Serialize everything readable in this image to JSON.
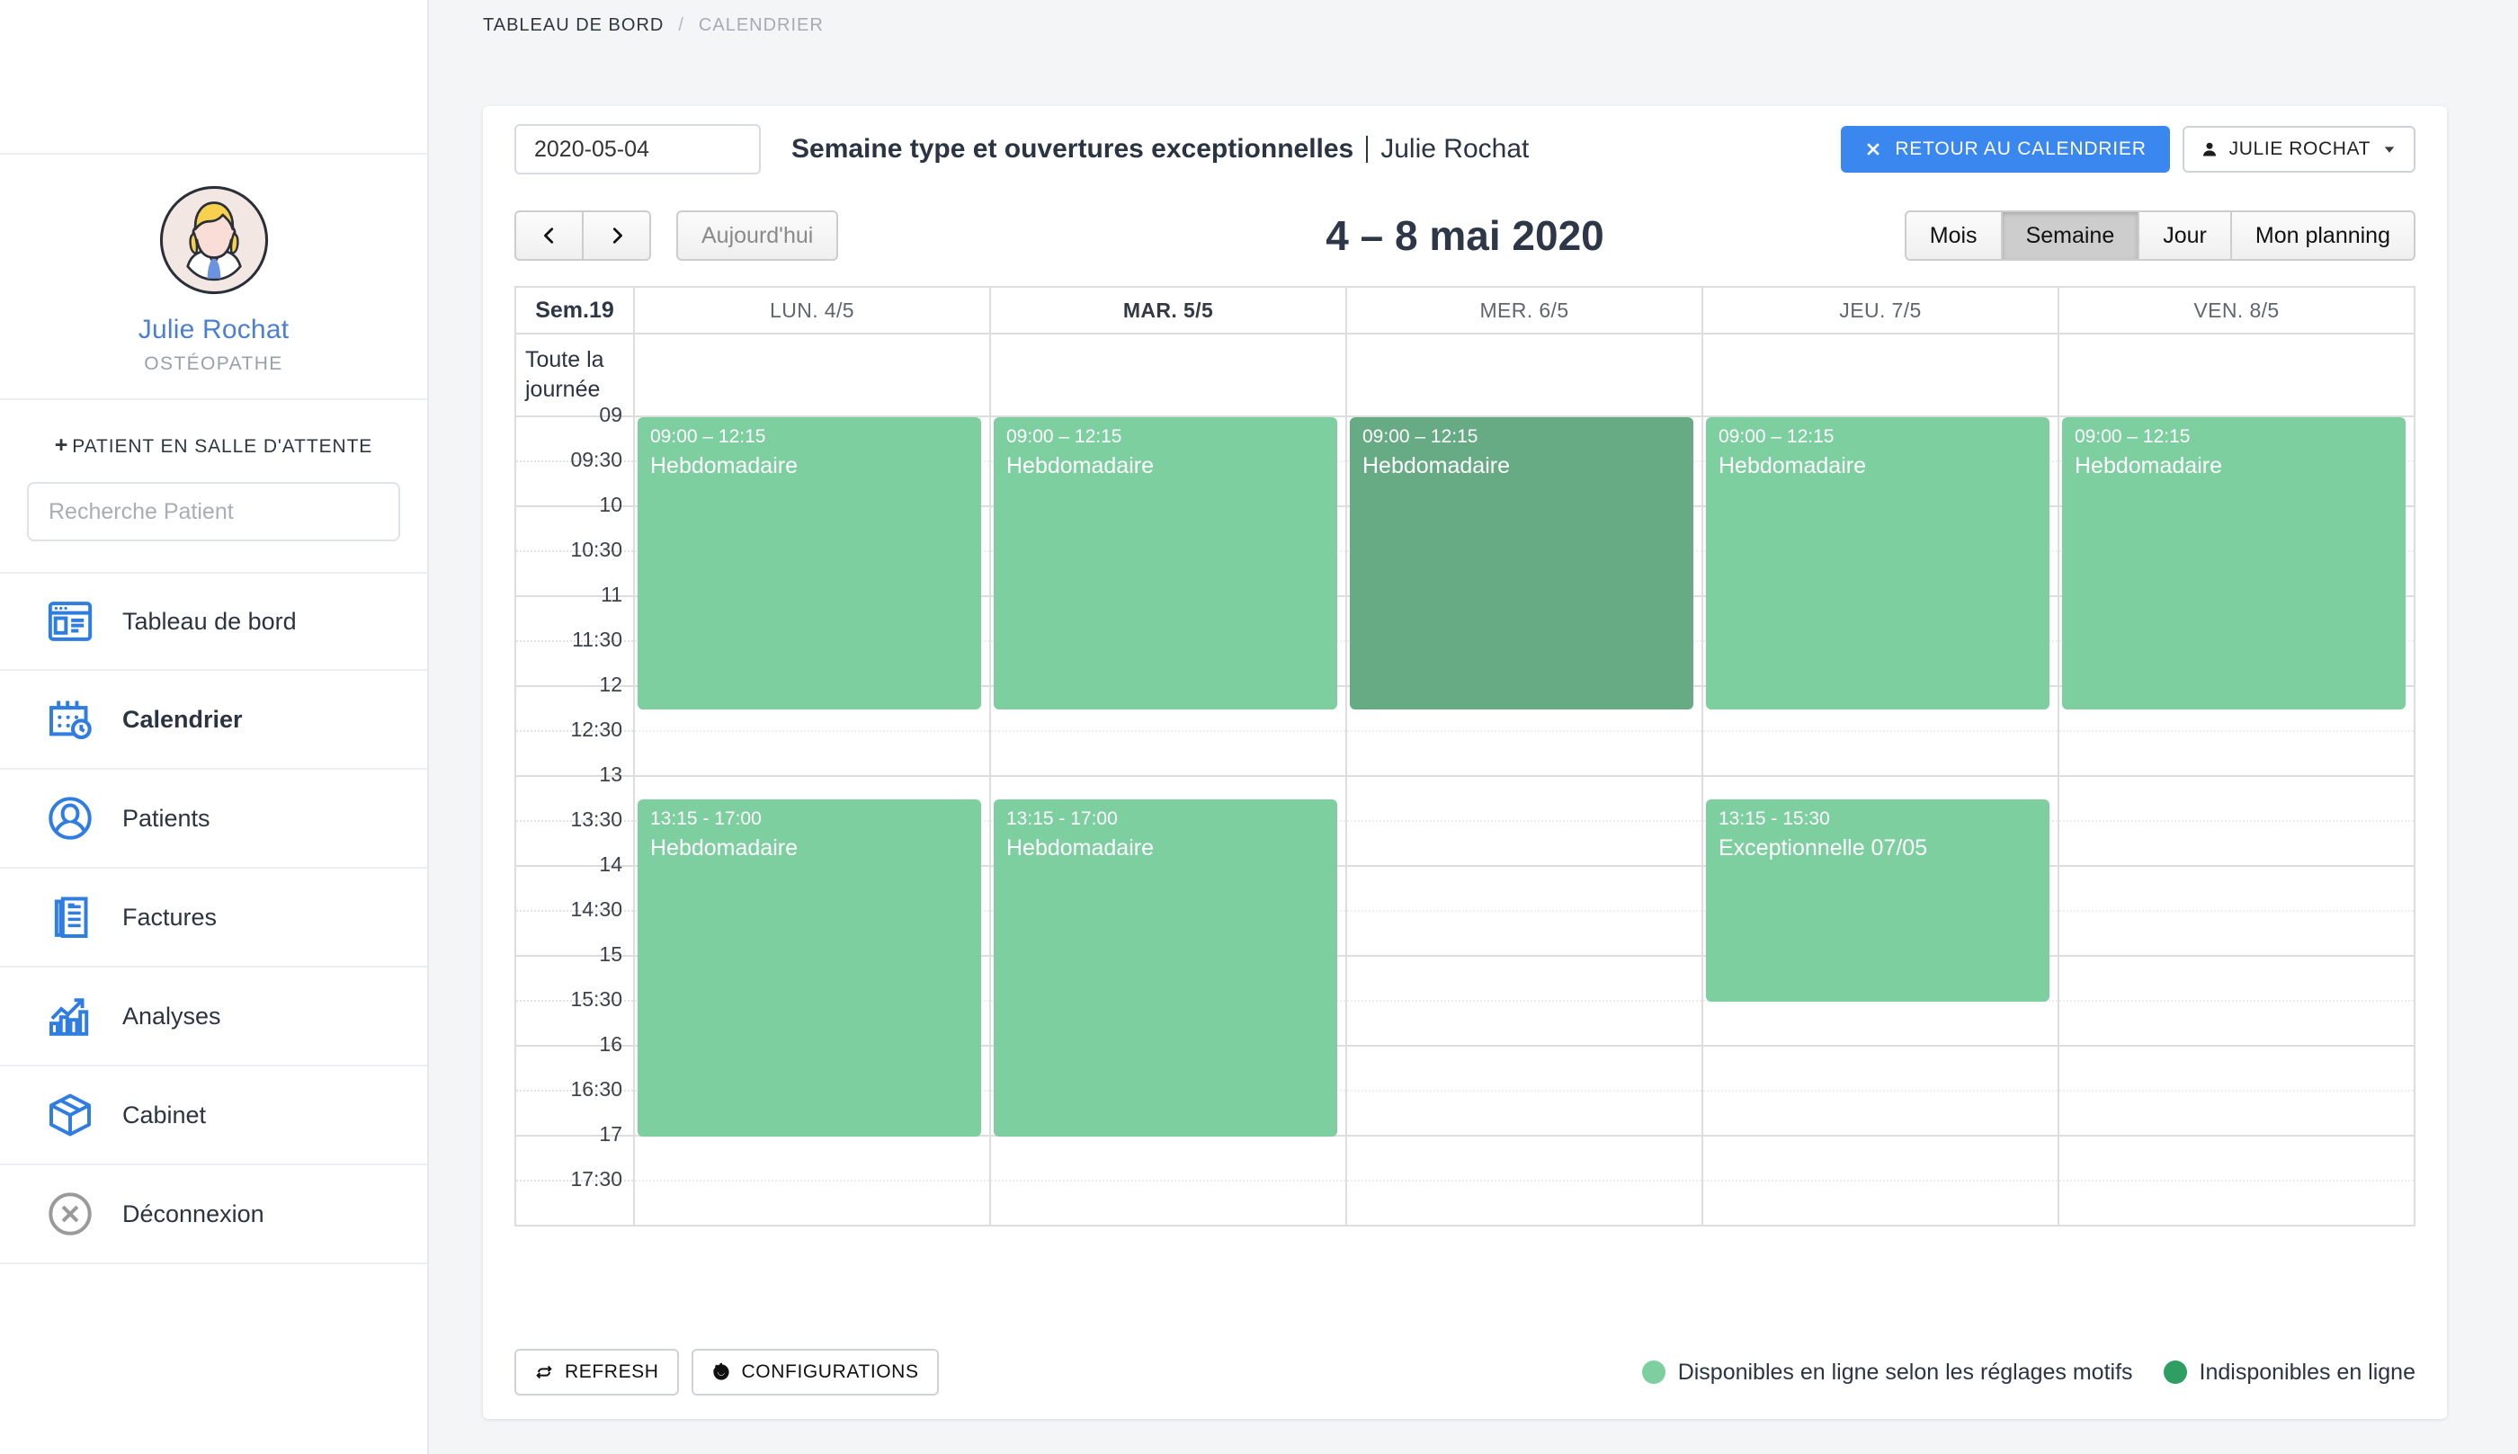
{
  "breadcrumb": {
    "root": "TABLEAU DE BORD",
    "separator": "/",
    "current": "CALENDRIER"
  },
  "sidebar": {
    "profile": {
      "name": "Julie Rochat",
      "role": "OSTÉOPATHE",
      "avatar_icon": "female-doctor-avatar"
    },
    "waiting_room_button": {
      "plus": "+",
      "label": "PATIENT EN SALLE D'ATTENTE"
    },
    "search": {
      "placeholder": "Recherche Patient",
      "value": ""
    },
    "items": [
      {
        "label": "Tableau de bord",
        "icon": "dashboard-icon",
        "active": false
      },
      {
        "label": "Calendrier",
        "icon": "calendar-clock-icon",
        "active": true
      },
      {
        "label": "Patients",
        "icon": "user-circle-icon",
        "active": false
      },
      {
        "label": "Factures",
        "icon": "invoice-document-icon",
        "active": false
      },
      {
        "label": "Analyses",
        "icon": "bar-chart-arrow-icon",
        "active": false
      },
      {
        "label": "Cabinet",
        "icon": "box-icon",
        "active": false
      },
      {
        "label": "Déconnexion",
        "icon": "logout-circle-x-icon",
        "active": false
      }
    ]
  },
  "header": {
    "date_input_value": "2020-05-04",
    "title": "Semaine type et ouvertures exceptionnelles",
    "subtitle": "Julie Rochat",
    "back_button": {
      "label": "RETOUR AU CALENDRIER",
      "icon": "close-x-icon",
      "color": "#3b87f0"
    },
    "user_menu": {
      "label": "JULIE ROCHAT",
      "icon": "user-icon",
      "caret": "chevron-down-icon"
    }
  },
  "toolbar": {
    "prev_label": "‹",
    "next_label": "›",
    "today_label": "Aujourd'hui",
    "week_title": "4 – 8 mai 2020",
    "views": [
      {
        "label": "Mois",
        "active": false
      },
      {
        "label": "Semaine",
        "active": true
      },
      {
        "label": "Jour",
        "active": false
      },
      {
        "label": "Mon planning",
        "active": false
      }
    ]
  },
  "calendar": {
    "week_label": "Sem.19",
    "all_day_label_line1": "Toute la",
    "all_day_label_line2": "journée",
    "days": [
      {
        "label": "LUN. 4/5",
        "today": false
      },
      {
        "label": "MAR. 5/5",
        "today": true
      },
      {
        "label": "MER. 6/5",
        "today": false
      },
      {
        "label": "JEU. 7/5",
        "today": false
      },
      {
        "label": "VEN. 8/5",
        "today": false
      }
    ],
    "time_labels": [
      "09",
      "09:30",
      "10",
      "10:30",
      "11",
      "11:30",
      "12",
      "12:30",
      "13",
      "13:30",
      "14",
      "14:30",
      "15",
      "15:30",
      "16",
      "16:30",
      "17",
      "17:30"
    ],
    "colors": {
      "available": "#7dcfa0",
      "unavailable": "#66ab83"
    },
    "events": [
      {
        "day": 0,
        "time": "09:00 – 12:15",
        "title": "Hebdomadaire",
        "start_min": 0,
        "end_min": 195,
        "color": "#7dcfa0"
      },
      {
        "day": 1,
        "time": "09:00 – 12:15",
        "title": "Hebdomadaire",
        "start_min": 0,
        "end_min": 195,
        "color": "#7dcfa0"
      },
      {
        "day": 2,
        "time": "09:00 – 12:15",
        "title": "Hebdomadaire",
        "start_min": 0,
        "end_min": 195,
        "color": "#66ab83"
      },
      {
        "day": 3,
        "time": "09:00 – 12:15",
        "title": "Hebdomadaire",
        "start_min": 0,
        "end_min": 195,
        "color": "#7dcfa0"
      },
      {
        "day": 4,
        "time": "09:00 – 12:15",
        "title": "Hebdomadaire",
        "start_min": 0,
        "end_min": 195,
        "color": "#7dcfa0"
      },
      {
        "day": 0,
        "time": "13:15 - 17:00",
        "title": "Hebdomadaire",
        "start_min": 255,
        "end_min": 480,
        "color": "#7dcfa0"
      },
      {
        "day": 1,
        "time": "13:15 - 17:00",
        "title": "Hebdomadaire",
        "start_min": 255,
        "end_min": 480,
        "color": "#7dcfa0"
      },
      {
        "day": 3,
        "time": "13:15 - 15:30",
        "title": "Exceptionnelle 07/05",
        "start_min": 255,
        "end_min": 390,
        "color": "#7dcfa0"
      }
    ]
  },
  "footer": {
    "refresh_label": "REFRESH",
    "refresh_icon": "refresh-icon",
    "configurations_label": "CONFIGURATIONS",
    "configurations_icon": "gear-icon",
    "legend": [
      {
        "label": "Disponibles en ligne selon les réglages motifs",
        "color": "#7dcfa0"
      },
      {
        "label": "Indisponibles en ligne",
        "color": "#2e9e63"
      }
    ]
  }
}
